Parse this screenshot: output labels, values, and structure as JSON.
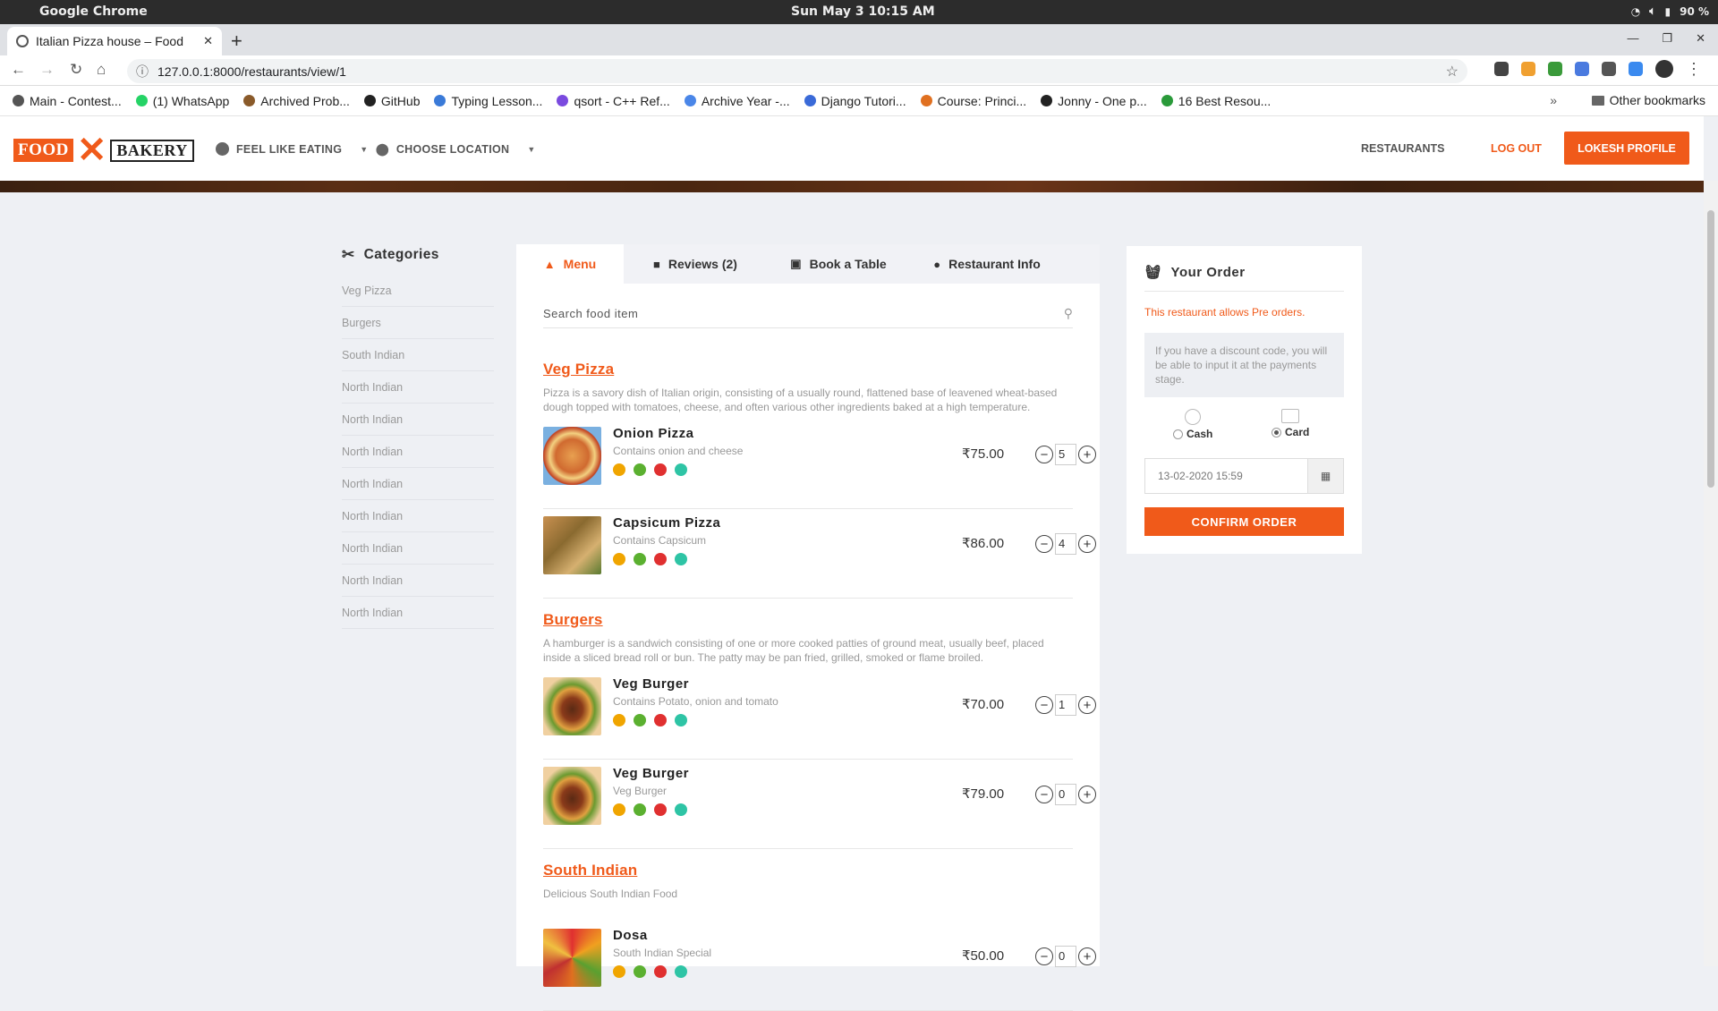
{
  "os": {
    "app_name": "Google Chrome",
    "clock": "Sun May 3  10:15 AM",
    "battery": "90 %"
  },
  "browser": {
    "tab_title": "Italian Pizza house – Food",
    "url": "127.0.0.1:8000/restaurants/view/1",
    "bookmarks": [
      "Main - Contest...",
      "(1) WhatsApp",
      "Archived Prob...",
      "GitHub",
      "Typing Lesson...",
      "qsort - C++ Ref...",
      "Archive Year -...",
      "Django Tutori...",
      "Course: Princi...",
      "Jonny - One p...",
      "16 Best Resou..."
    ],
    "more_bookmarks": "»",
    "other_bookmarks": "Other bookmarks"
  },
  "site": {
    "logo_left": "FOOD",
    "logo_right": "BAKERY",
    "feel_like_eating": "FEEL LIKE EATING",
    "choose_location": "CHOOSE LOCATION",
    "restaurants": "RESTAURANTS",
    "logout": "LOG OUT",
    "profile": "LOKESH PROFILE"
  },
  "categories": {
    "title": "Categories",
    "items": [
      "Veg Pizza",
      "Burgers",
      "South Indian",
      "North Indian",
      "North Indian",
      "North Indian",
      "North Indian",
      "North Indian",
      "North Indian",
      "North Indian",
      "North Indian"
    ]
  },
  "tabs": [
    {
      "label": "Menu"
    },
    {
      "label": "Reviews (2)"
    },
    {
      "label": "Book a Table"
    },
    {
      "label": "Restaurant Info"
    }
  ],
  "search": {
    "placeholder": "Search food item"
  },
  "sections": [
    {
      "title": "Veg Pizza",
      "desc": "Pizza is a savory dish of Italian origin, consisting of a usually round, flattened base of leavened wheat-based dough topped with tomatoes, cheese, and often various other ingredients baked at a high temperature."
    },
    {
      "title": "Burgers",
      "desc": "A hamburger is a sandwich consisting of one or more cooked patties of ground meat, usually beef, placed inside a sliced bread roll or bun. The patty may be pan fried, grilled, smoked or flame broiled."
    },
    {
      "title": "South Indian",
      "desc": "Delicious South Indian Food"
    }
  ],
  "items": [
    {
      "name": "Onion Pizza",
      "desc": "Contains onion and cheese",
      "price": "₹75.00",
      "qty": "5"
    },
    {
      "name": "Capsicum Pizza",
      "desc": "Contains Capsicum",
      "price": "₹86.00",
      "qty": "4"
    },
    {
      "name": "Veg Burger",
      "desc": "Contains Potato, onion and tomato",
      "price": "₹70.00",
      "qty": "1"
    },
    {
      "name": "Veg Burger",
      "desc": "Veg Burger",
      "price": "₹79.00",
      "qty": "0"
    },
    {
      "name": "Dosa",
      "desc": "South Indian Special",
      "price": "₹50.00",
      "qty": "0"
    }
  ],
  "order": {
    "title": "Your Order",
    "preorder_note": "This restaurant allows Pre orders.",
    "discount_note": "If you have a discount code, you will be able to input it at the payments stage.",
    "cash_label": "Cash",
    "card_label": "Card",
    "selected_payment": "Card",
    "datetime": "13-02-2020 15:59",
    "confirm_label": "CONFIRM ORDER"
  },
  "colors": {
    "accent": "#f05a1a",
    "tag_colors": [
      "#f0a500",
      "#5bb030",
      "#e03030",
      "#2ec4a5"
    ]
  }
}
